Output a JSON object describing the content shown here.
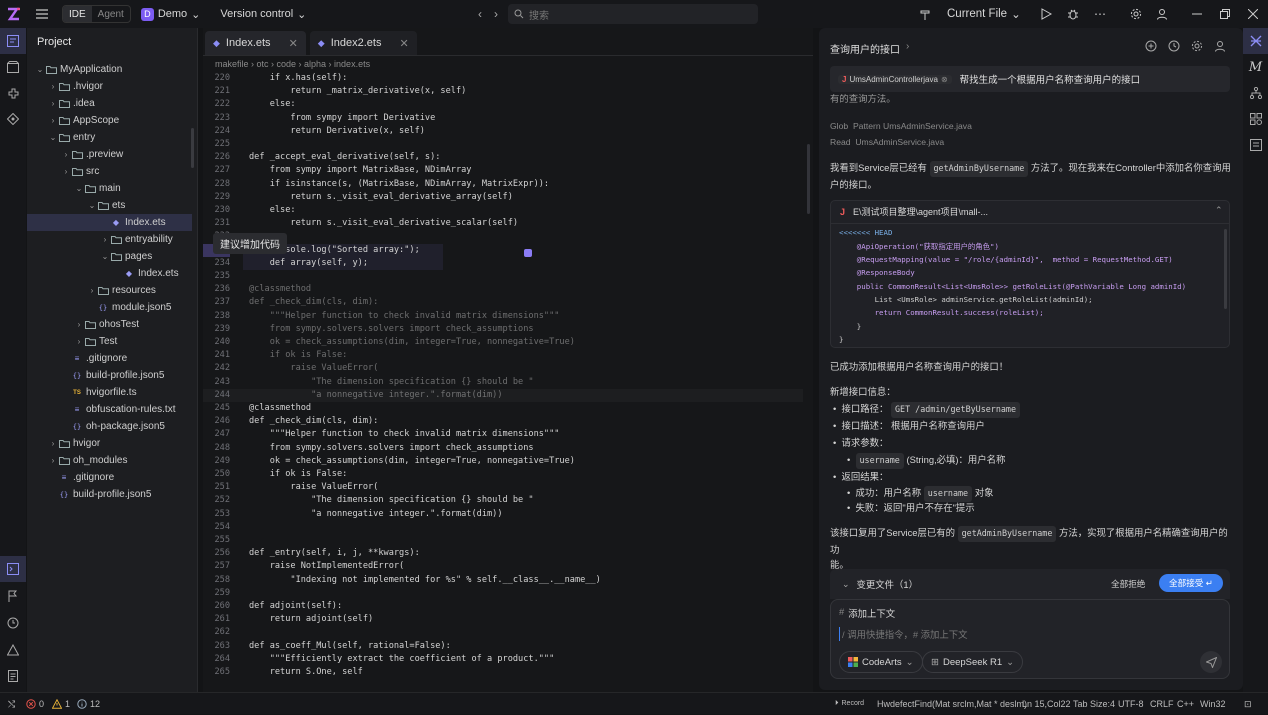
{
  "titlebar": {
    "ide_tab": "IDE",
    "agent_tab": "Agent",
    "project_badge": "D",
    "project_name": "Demo",
    "version_control": "Version control",
    "search_placeholder": "搜索",
    "run_config": "Current File"
  },
  "project": {
    "title": "Project",
    "tree": [
      {
        "label": "MyApplication",
        "depth": 0,
        "arrow": "v",
        "icon": "folder"
      },
      {
        "label": ".hvigor",
        "depth": 1,
        "arrow": ">",
        "icon": "folder"
      },
      {
        "label": ".idea",
        "depth": 1,
        "arrow": ">",
        "icon": "folder"
      },
      {
        "label": "AppScope",
        "depth": 1,
        "arrow": ">",
        "icon": "folder"
      },
      {
        "label": "entry",
        "depth": 1,
        "arrow": "v",
        "icon": "folder"
      },
      {
        "label": ".preview",
        "depth": 2,
        "arrow": ">",
        "icon": "folder"
      },
      {
        "label": "src",
        "depth": 2,
        "arrow": ">",
        "icon": "folder"
      },
      {
        "label": "main",
        "depth": 3,
        "arrow": "v",
        "icon": "folder"
      },
      {
        "label": "ets",
        "depth": 4,
        "arrow": "v",
        "icon": "folder"
      },
      {
        "label": "Index.ets",
        "depth": 5,
        "arrow": "",
        "icon": "ets",
        "selected": true
      },
      {
        "label": "entryability",
        "depth": 5,
        "arrow": ">",
        "icon": "folder"
      },
      {
        "label": "pages",
        "depth": 5,
        "arrow": "v",
        "icon": "folder"
      },
      {
        "label": "Index.ets",
        "depth": 6,
        "arrow": "",
        "icon": "ets"
      },
      {
        "label": "resources",
        "depth": 4,
        "arrow": ">",
        "icon": "folder"
      },
      {
        "label": "module.json5",
        "depth": 4,
        "arrow": "",
        "icon": "json"
      },
      {
        "label": "ohosTest",
        "depth": 3,
        "arrow": ">",
        "icon": "folder"
      },
      {
        "label": "Test",
        "depth": 3,
        "arrow": ">",
        "icon": "folder"
      },
      {
        "label": ".gitignore",
        "depth": 2,
        "arrow": "",
        "icon": "file"
      },
      {
        "label": "build-profile.json5",
        "depth": 2,
        "arrow": "",
        "icon": "json"
      },
      {
        "label": "hvigorfile.ts",
        "depth": 2,
        "arrow": "",
        "icon": "ts"
      },
      {
        "label": "obfuscation-rules.txt",
        "depth": 2,
        "arrow": "",
        "icon": "file"
      },
      {
        "label": "oh-package.json5",
        "depth": 2,
        "arrow": "",
        "icon": "json"
      },
      {
        "label": "hvigor",
        "depth": 1,
        "arrow": ">",
        "icon": "folder"
      },
      {
        "label": "oh_modules",
        "depth": 1,
        "arrow": ">",
        "icon": "folder"
      },
      {
        "label": ".gitignore",
        "depth": 1,
        "arrow": "",
        "icon": "file"
      },
      {
        "label": "build-profile.json5",
        "depth": 1,
        "arrow": "",
        "icon": "json"
      }
    ]
  },
  "editor": {
    "tabs": [
      {
        "label": "Index.ets",
        "active": true
      },
      {
        "label": "Index2.ets",
        "active": false
      }
    ],
    "breadcrumb": "makefile › otc › code › alpha › index.ets",
    "tooltip": "建议增加代码",
    "lines": [
      {
        "no": "220",
        "code": "    if x.has(self):"
      },
      {
        "no": "221",
        "code": "        return _matrix_derivative(x, self)"
      },
      {
        "no": "222",
        "code": "    else:"
      },
      {
        "no": "223",
        "code": "        from sympy import Derivative"
      },
      {
        "no": "224",
        "code": "        return Derivative(x, self)"
      },
      {
        "no": "225",
        "code": ""
      },
      {
        "no": "226",
        "code": "def _accept_eval_derivative(self, s):"
      },
      {
        "no": "227",
        "code": "    from sympy import MatrixBase, NDimArray"
      },
      {
        "no": "228",
        "code": "    if isinstance(s, (MatrixBase, NDimArray, MatrixExpr)):"
      },
      {
        "no": "229",
        "code": "        return s._visit_eval_derivative_array(self)"
      },
      {
        "no": "230",
        "code": "    else:"
      },
      {
        "no": "231",
        "code": "        return s._visit_eval_derivative_scalar(self)"
      },
      {
        "no": "232",
        "code": ""
      },
      {
        "no": "233",
        "code": "    console.log(\"Sorted array:\");"
      },
      {
        "no": "234",
        "code": "    def array(self, y);"
      },
      {
        "no": "235",
        "code": ""
      },
      {
        "no": "236",
        "code": "@classmethod"
      },
      {
        "no": "237",
        "code": "def _check_dim(cls, dim):"
      },
      {
        "no": "238",
        "code": "    \"\"\"Helper function to check invalid matrix dimensions\"\"\""
      },
      {
        "no": "239",
        "code": "    from sympy.solvers.solvers import check_assumptions"
      },
      {
        "no": "240",
        "code": "    ok = check_assumptions(dim, integer=True, nonnegative=True)"
      },
      {
        "no": "241",
        "code": "    if ok is False:"
      },
      {
        "no": "242",
        "code": "        raise ValueError("
      },
      {
        "no": "243",
        "code": "            \"The dimension specification {} should be \""
      },
      {
        "no": "244",
        "code": "            \"a nonnegative integer.\".format(dim))"
      },
      {
        "no": "245",
        "code": "@classmethod"
      },
      {
        "no": "246",
        "code": "def _check_dim(cls, dim):"
      },
      {
        "no": "247",
        "code": "    \"\"\"Helper function to check invalid matrix dimensions\"\"\""
      },
      {
        "no": "248",
        "code": "    from sympy.solvers.solvers import check_assumptions"
      },
      {
        "no": "249",
        "code": "    ok = check_assumptions(dim, integer=True, nonnegative=True)"
      },
      {
        "no": "250",
        "code": "    if ok is False:"
      },
      {
        "no": "251",
        "code": "        raise ValueError("
      },
      {
        "no": "252",
        "code": "            \"The dimension specification {} should be \""
      },
      {
        "no": "253",
        "code": "            \"a nonnegative integer.\".format(dim))"
      },
      {
        "no": "254",
        "code": ""
      },
      {
        "no": "255",
        "code": ""
      },
      {
        "no": "256",
        "code": "def _entry(self, i, j, **kwargs):"
      },
      {
        "no": "257",
        "code": "    raise NotImplementedError("
      },
      {
        "no": "258",
        "code": "        \"Indexing not implemented for %s\" % self.__class__.__name__)"
      },
      {
        "no": "259",
        "code": ""
      },
      {
        "no": "260",
        "code": "def adjoint(self):"
      },
      {
        "no": "261",
        "code": "    return adjoint(self)"
      },
      {
        "no": "262",
        "code": ""
      },
      {
        "no": "263",
        "code": "def as_coeff_Mul(self, rational=False):"
      },
      {
        "no": "264",
        "code": "    \"\"\"Efficiently extract the coefficient of a product.\"\"\""
      },
      {
        "no": "265",
        "code": "    return S.One, self"
      }
    ]
  },
  "agent": {
    "title": "查询用户的接口",
    "query_chip": "UmsAdminControllerjava",
    "query_text": "帮找生成一个根据用户名称查询用户的接口",
    "clipped_text": "有的查询方法。",
    "glob_label": "Glob",
    "glob_value": "Pattern  UmsAdminService.java",
    "read_label": "Read",
    "read_value": "UmsAdminService.java",
    "para1_a": "我看到Service层已经有",
    "para1_chip": "getAdminByUsername",
    "para1_b": "方法了。现在我来在Controller中添加名你查询用",
    "para1_c": "户的接口。",
    "file_path": "E\\测试项目整理\\agent项目\\mall-...",
    "code_lines": [
      "<<<<<<< HEAD",
      "    @ApiOperation(\"获取指定用户的角色\")",
      "    @RequestMapping(value = \"/role/{adminId}\",  method = RequestMethod.GET)",
      "    @ResponseBody",
      "    public CommonResult<List<UmsRole>> getRoleList(@PathVariable Long adminId)",
      "        List <UmsRole> adminService.getRoleList(adminId);",
      "        return CommonResult.success(roleList);",
      "    }",
      "}"
    ],
    "success": "已成功添加根据用户名称查询用户的接口！",
    "info_title": "新增接口信息：",
    "path_label": "接口路径：",
    "path_value": "GET /admin/getByUsername",
    "desc_label": "接口描述：",
    "desc_value": "根据用户名称查询用户",
    "params_label": "请求参数：",
    "param_chip": "username",
    "param_desc": "(String,必填)：用户名称",
    "result_label": "返回结果：",
    "ok_label": "成功：用户名称",
    "ok_chip": "username",
    "ok_suffix": "对象",
    "fail_text": "失败：返回\"用户不存在\"提示",
    "para2_a": "该接口复用了Service层已有的",
    "para2_chip": "getAdminByUsername",
    "para2_b": "方法，实现了根据用户名精确查询用户的功",
    "para2_c": "能。",
    "changes_label": "变更文件（1）",
    "reject_all": "全部拒绝",
    "accept_all": "全部接受",
    "context_label": "添加上下文",
    "input_placeholder": "/ 调用快捷指令，# 添加上下文",
    "codearts": "CodeArts",
    "model": "DeepSeek R1"
  },
  "status": {
    "errors": "0",
    "warnings": "1",
    "infos": "12",
    "record": "Record",
    "func": "HwdefectFind(Mat srclm,Mat * deslm)",
    "pos": "Ln 15,Col22",
    "tab": "Tab Size:4",
    "enc": "UTF-8",
    "eol": "CRLF",
    "lang": "C++",
    "plat": "Win32"
  },
  "colors": {
    "accent": "#3b7ff2",
    "logo": "#a855f7",
    "selection": "#2e3046",
    "error": "#e5534b",
    "warning": "#e8b339"
  }
}
